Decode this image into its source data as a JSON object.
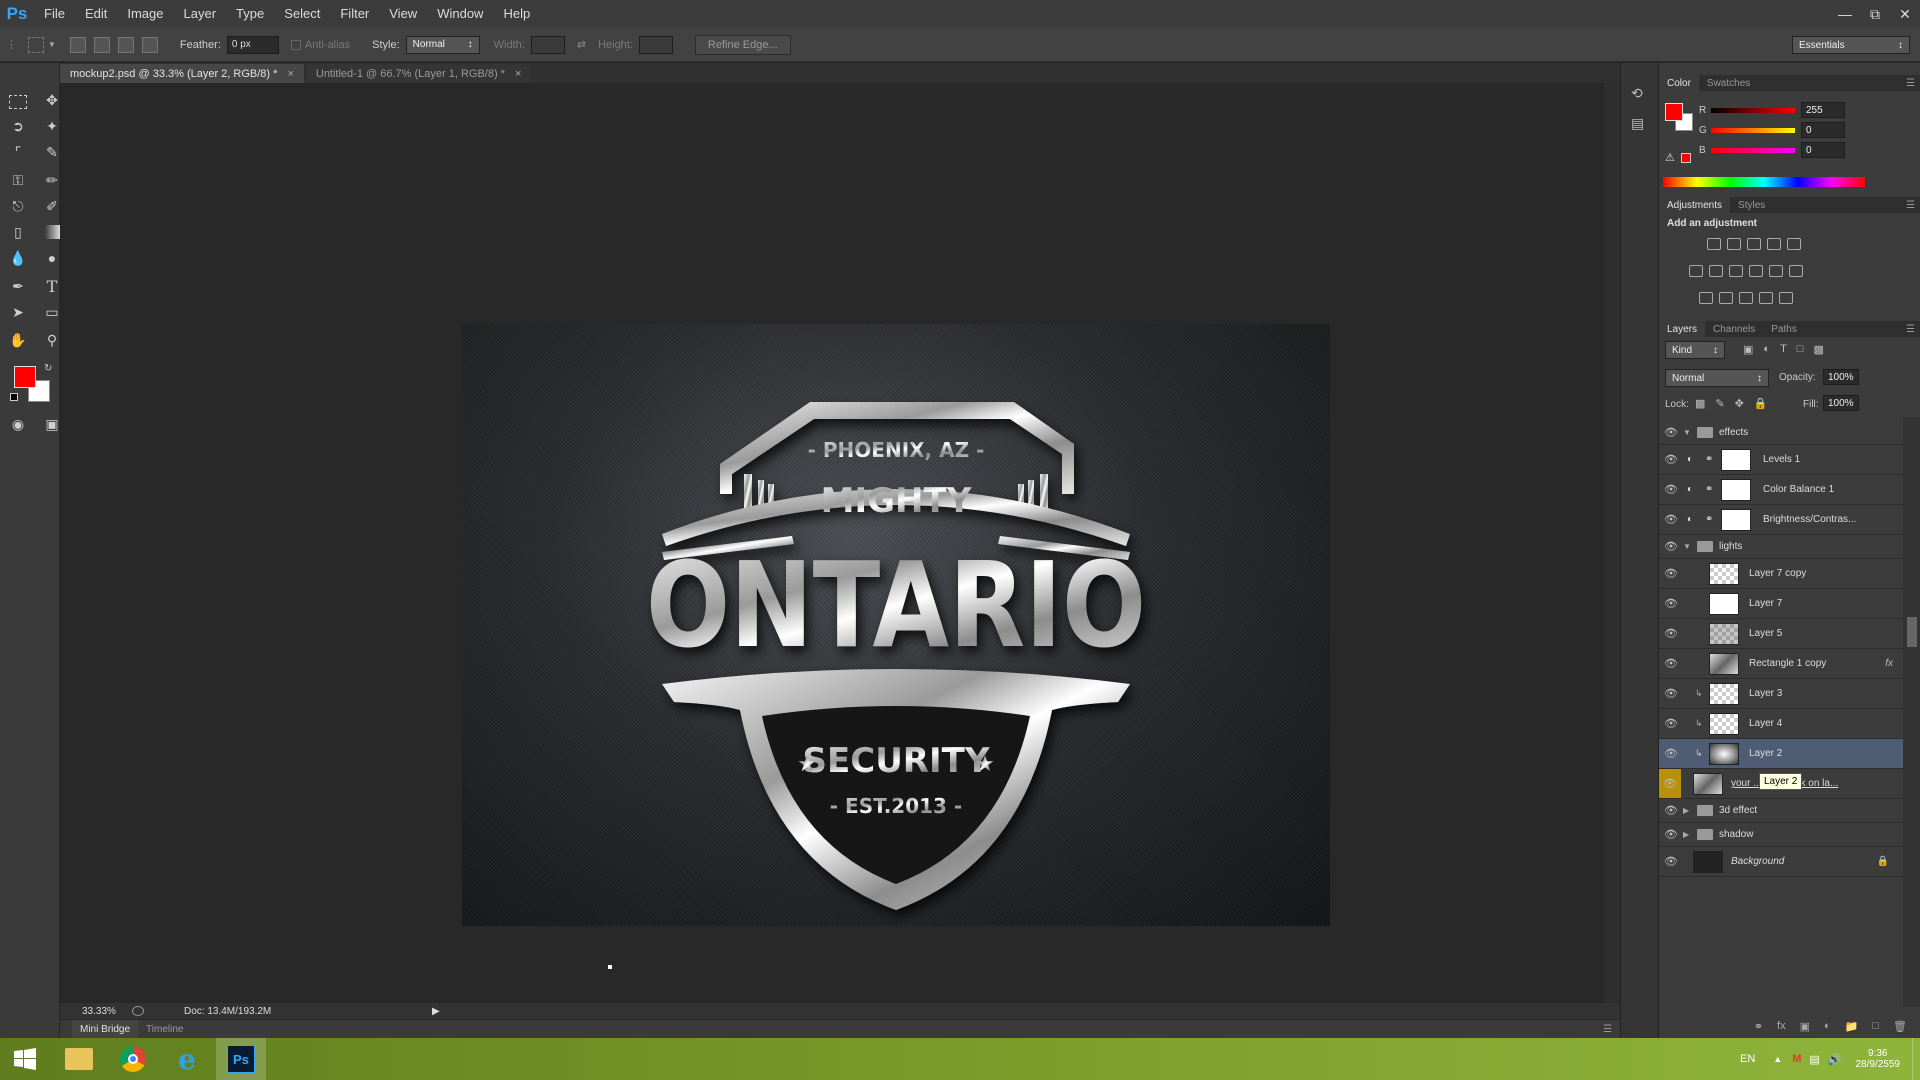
{
  "app": {
    "logo": "Ps"
  },
  "menu": [
    "File",
    "Edit",
    "Image",
    "Layer",
    "Type",
    "Select",
    "Filter",
    "View",
    "Window",
    "Help"
  ],
  "options": {
    "feather_label": "Feather:",
    "feather_value": "0 px",
    "antialias_label": "Anti-alias",
    "style_label": "Style:",
    "style_value": "Normal",
    "width_label": "Width:",
    "height_label": "Height:",
    "refine_edge": "Refine Edge...",
    "workspace": "Essentials"
  },
  "doc_tabs": [
    {
      "label": "mockup2.psd @ 33.3% (Layer 2, RGB/8) *",
      "active": true
    },
    {
      "label": "Untitled-1 @ 66.7% (Layer 1, RGB/8) *",
      "active": false
    }
  ],
  "artwork": {
    "line1": "- PHOENIX, AZ -",
    "line2": "MIGHTY",
    "line3": "ONTARIO",
    "line4": "SECURITY",
    "line5": "- EST.2013 -"
  },
  "status": {
    "zoom": "33.33%",
    "doc": "Doc: 13.4M/193.2M"
  },
  "bottom_tabs": [
    "Mini Bridge",
    "Timeline"
  ],
  "color_panel": {
    "tabs": [
      "Color",
      "Swatches"
    ],
    "fg_color": "#ff0000",
    "channels": [
      {
        "name": "R",
        "value": "255"
      },
      {
        "name": "G",
        "value": "0"
      },
      {
        "name": "B",
        "value": "0"
      }
    ]
  },
  "adjustments": {
    "tabs": [
      "Adjustments",
      "Styles"
    ],
    "title": "Add an adjustment"
  },
  "layers_panel": {
    "tabs": [
      "Layers",
      "Channels",
      "Paths"
    ],
    "filter": "Kind",
    "blend": "Normal",
    "opacity_label": "Opacity:",
    "opacity": "100%",
    "lock_label": "Lock:",
    "fill_label": "Fill:",
    "fill": "100%",
    "layers": [
      {
        "name": "effects",
        "kind": "group"
      },
      {
        "name": "Levels 1",
        "kind": "adj"
      },
      {
        "name": "Color Balance 1",
        "kind": "adj"
      },
      {
        "name": "Brightness/Contras...",
        "kind": "adj"
      },
      {
        "name": "lights",
        "kind": "group"
      },
      {
        "name": "Layer 7 copy",
        "kind": "layer"
      },
      {
        "name": "Layer 7",
        "kind": "layer"
      },
      {
        "name": "Layer 5",
        "kind": "layer"
      },
      {
        "name": "Rectangle 1 copy",
        "kind": "smart"
      },
      {
        "name": "Layer 3",
        "kind": "layer"
      },
      {
        "name": "Layer 4",
        "kind": "layer"
      },
      {
        "name": "Layer 2",
        "kind": "layer"
      },
      {
        "name": "your ...oubleclick on la...",
        "kind": "smart"
      },
      {
        "name": "3d effect",
        "kind": "closed-group"
      },
      {
        "name": "shadow",
        "kind": "closed-group"
      },
      {
        "name": "Background",
        "kind": "bg"
      }
    ],
    "tooltip": "Layer 2"
  },
  "taskbar": {
    "lang": "EN",
    "time": "9:36",
    "date": "28/9/2559"
  }
}
